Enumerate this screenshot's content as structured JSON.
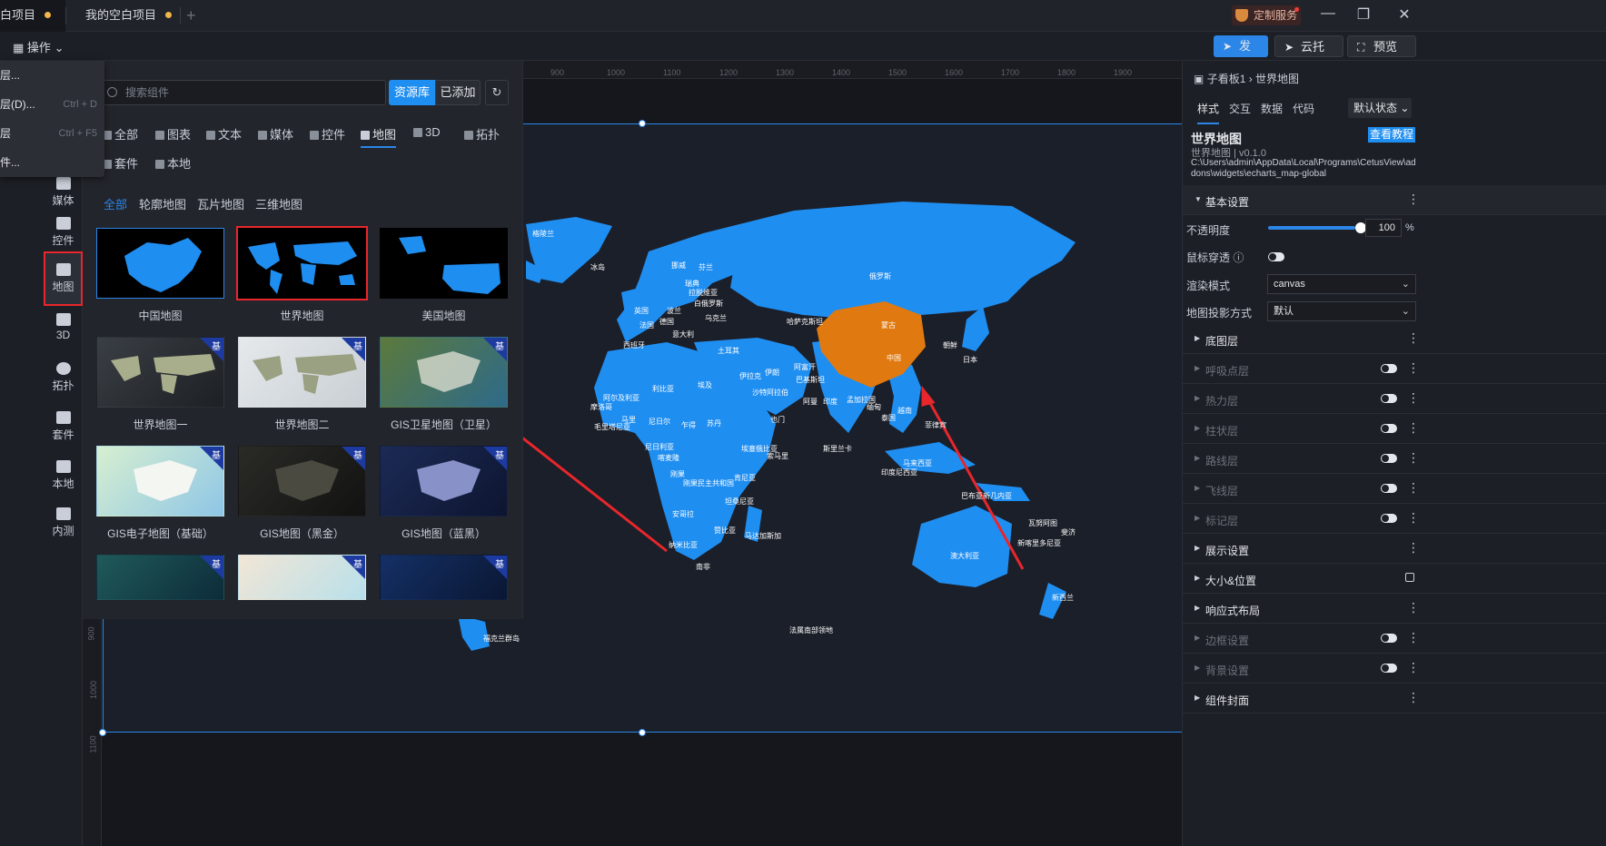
{
  "tabs": [
    {
      "label": "白项目"
    },
    {
      "label": "我的空白项目"
    }
  ],
  "top": {
    "custom_service": "定制服务",
    "op_menu": "操作",
    "publish": "发布",
    "cloud": "云托管",
    "preview": "预览"
  },
  "context_menu": [
    {
      "label": "层...",
      "shortcut": ""
    },
    {
      "label": "层(D)...",
      "shortcut": "Ctrl + D"
    },
    {
      "label": "层",
      "shortcut": "Ctrl + F5"
    },
    {
      "label": "件...",
      "shortcut": ""
    }
  ],
  "rail": [
    {
      "label": "媒体",
      "icon": "media-icon"
    },
    {
      "label": "控件",
      "icon": "control-icon"
    },
    {
      "label": "地图",
      "icon": "map-icon"
    },
    {
      "label": "3D",
      "icon": "cube-icon"
    },
    {
      "label": "拓扑",
      "icon": "topology-icon"
    },
    {
      "label": "套件",
      "icon": "kit-icon"
    },
    {
      "label": "本地",
      "icon": "puzzle-icon"
    },
    {
      "label": "内测",
      "icon": "bar-chart-icon"
    }
  ],
  "panel": {
    "search_placeholder": "搜索组件",
    "lib": "资源库",
    "added": "已添加",
    "refresh_icon": "refresh-icon",
    "categories": [
      "全部",
      "图表",
      "文本",
      "媒体",
      "控件",
      "地图",
      "3D",
      "拓扑",
      "套件",
      "本地"
    ],
    "active_category": "地图",
    "filters": [
      "全部",
      "轮廓地图",
      "瓦片地图",
      "三维地图"
    ],
    "active_filter": "全部",
    "base_badge": "基",
    "cards": [
      {
        "label": "中国地图"
      },
      {
        "label": "世界地图"
      },
      {
        "label": "美国地图"
      },
      {
        "label": "世界地图一"
      },
      {
        "label": "世界地图二"
      },
      {
        "label": "GIS卫星地图（卫星）"
      },
      {
        "label": "GIS电子地图（基础）"
      },
      {
        "label": "GIS地图（黑金）"
      },
      {
        "label": "GIS地图（蓝黑）"
      },
      {
        "label": ""
      },
      {
        "label": ""
      },
      {
        "label": ""
      }
    ]
  },
  "ruler": {
    "top": [
      "900",
      "1000",
      "1100",
      "1200",
      "1300",
      "1400",
      "1500",
      "1600",
      "1700",
      "1800",
      "1900"
    ],
    "left": [
      "900",
      "1000",
      "1100"
    ]
  },
  "map_labels": [
    "格陵兰",
    "冰岛",
    "俄罗斯",
    "芬兰",
    "挪威",
    "瑞典",
    "拉脱维亚",
    "白俄罗斯",
    "波兰",
    "乌克兰",
    "英国",
    "法国",
    "德国",
    "西班牙",
    "意大利",
    "哈萨克斯坦",
    "蒙古",
    "中国",
    "日本",
    "朝鲜",
    "土耳其",
    "伊朗",
    "伊拉克",
    "阿富汗",
    "巴基斯坦",
    "印度",
    "孟加拉国",
    "缅甸",
    "泰国",
    "越南",
    "菲律宾",
    "马来西亚",
    "印度尼西亚",
    "巴布亚新几内亚",
    "澳大利亚",
    "新西兰",
    "新喀里多尼亚",
    "瓦努阿图",
    "斐济",
    "阿尔及利亚",
    "利比亚",
    "埃及",
    "苏丹",
    "乍得",
    "尼日尔",
    "马里",
    "毛里塔尼亚",
    "摩洛哥",
    "尼日利亚",
    "喀麦隆",
    "刚果",
    "刚果民主共和国",
    "安哥拉",
    "赞比亚",
    "纳米比亚",
    "南非",
    "坦桑尼亚",
    "肯尼亚",
    "埃塞俄比亚",
    "索马里",
    "马达加斯加",
    "沙特阿拉伯",
    "也门",
    "阿曼",
    "斯里兰卡",
    "法属南部领地",
    "福克兰群岛"
  ],
  "right": {
    "crumb": "子看板1 › 世界地图",
    "tabs": [
      "样式",
      "交互",
      "数据",
      "代码"
    ],
    "state": "默认状态",
    "title": "世界地图",
    "tutorial": "查看教程",
    "sub": "世界地图 | v0.1.0",
    "path": "C:\\Users\\admin\\AppData\\Local\\Programs\\CetusView\\addons\\widgets\\echarts_map-global",
    "basic": "基本设置",
    "opacity_label": "不透明度",
    "opacity_value": "100",
    "opacity_unit": "%",
    "opacity_fraction": 1.0,
    "mouse_through": "鼠标穿透",
    "render_mode_label": "渲染模式",
    "render_mode": "canvas",
    "projection_label": "地图投影方式",
    "projection": "默认",
    "sections": [
      {
        "label": "底图层",
        "dim": false,
        "control": "more"
      },
      {
        "label": "呼吸点层",
        "dim": true,
        "control": "toggle"
      },
      {
        "label": "热力层",
        "dim": true,
        "control": "toggle"
      },
      {
        "label": "柱状层",
        "dim": true,
        "control": "toggle"
      },
      {
        "label": "路线层",
        "dim": true,
        "control": "toggle"
      },
      {
        "label": "飞线层",
        "dim": true,
        "control": "toggle"
      },
      {
        "label": "标记层",
        "dim": true,
        "control": "toggle"
      },
      {
        "label": "展示设置",
        "dim": false,
        "control": "more"
      },
      {
        "label": "大小&位置",
        "dim": false,
        "control": "lock"
      },
      {
        "label": "响应式布局",
        "dim": false,
        "control": "more"
      },
      {
        "label": "边框设置",
        "dim": true,
        "control": "toggle"
      },
      {
        "label": "背景设置",
        "dim": true,
        "control": "toggle"
      },
      {
        "label": "组件封面",
        "dim": false,
        "control": "more"
      }
    ]
  },
  "colors": {
    "accent": "#2b86e8",
    "map_land": "#1f8ef1",
    "china_highlight": "#e0790f",
    "annotation_red": "#e8262c"
  }
}
